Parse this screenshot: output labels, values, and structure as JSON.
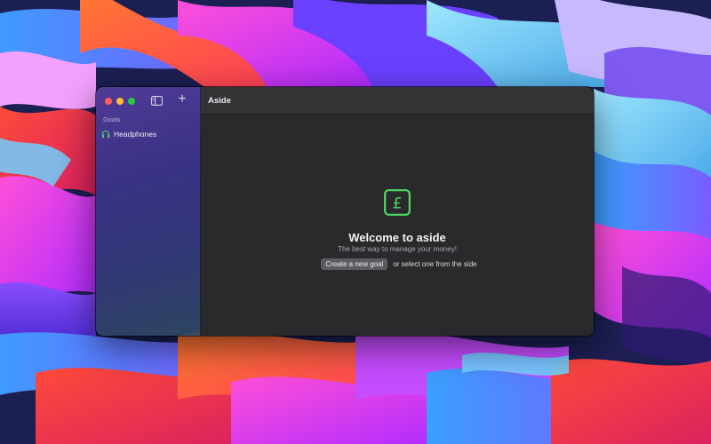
{
  "window": {
    "title": "Aside"
  },
  "sidebar": {
    "toggle_icon": "sidebar-toggle-icon",
    "add_icon": "plus-icon",
    "add_symbol": "+",
    "section_heading": "Goals",
    "goals": [
      {
        "label": "Headphones",
        "icon": "headphones-icon"
      }
    ]
  },
  "main": {
    "logo_icon": "pound-sign-icon",
    "welcome_title": "Welcome to aside",
    "welcome_subtitle": "The best way to manage your money!",
    "create_button_label": "Create a new goal",
    "hint_text": "or select one from the side"
  },
  "colors": {
    "accent": "#4cd964",
    "content_bg": "#2a2a2d",
    "titlebar_bg": "#333336"
  }
}
